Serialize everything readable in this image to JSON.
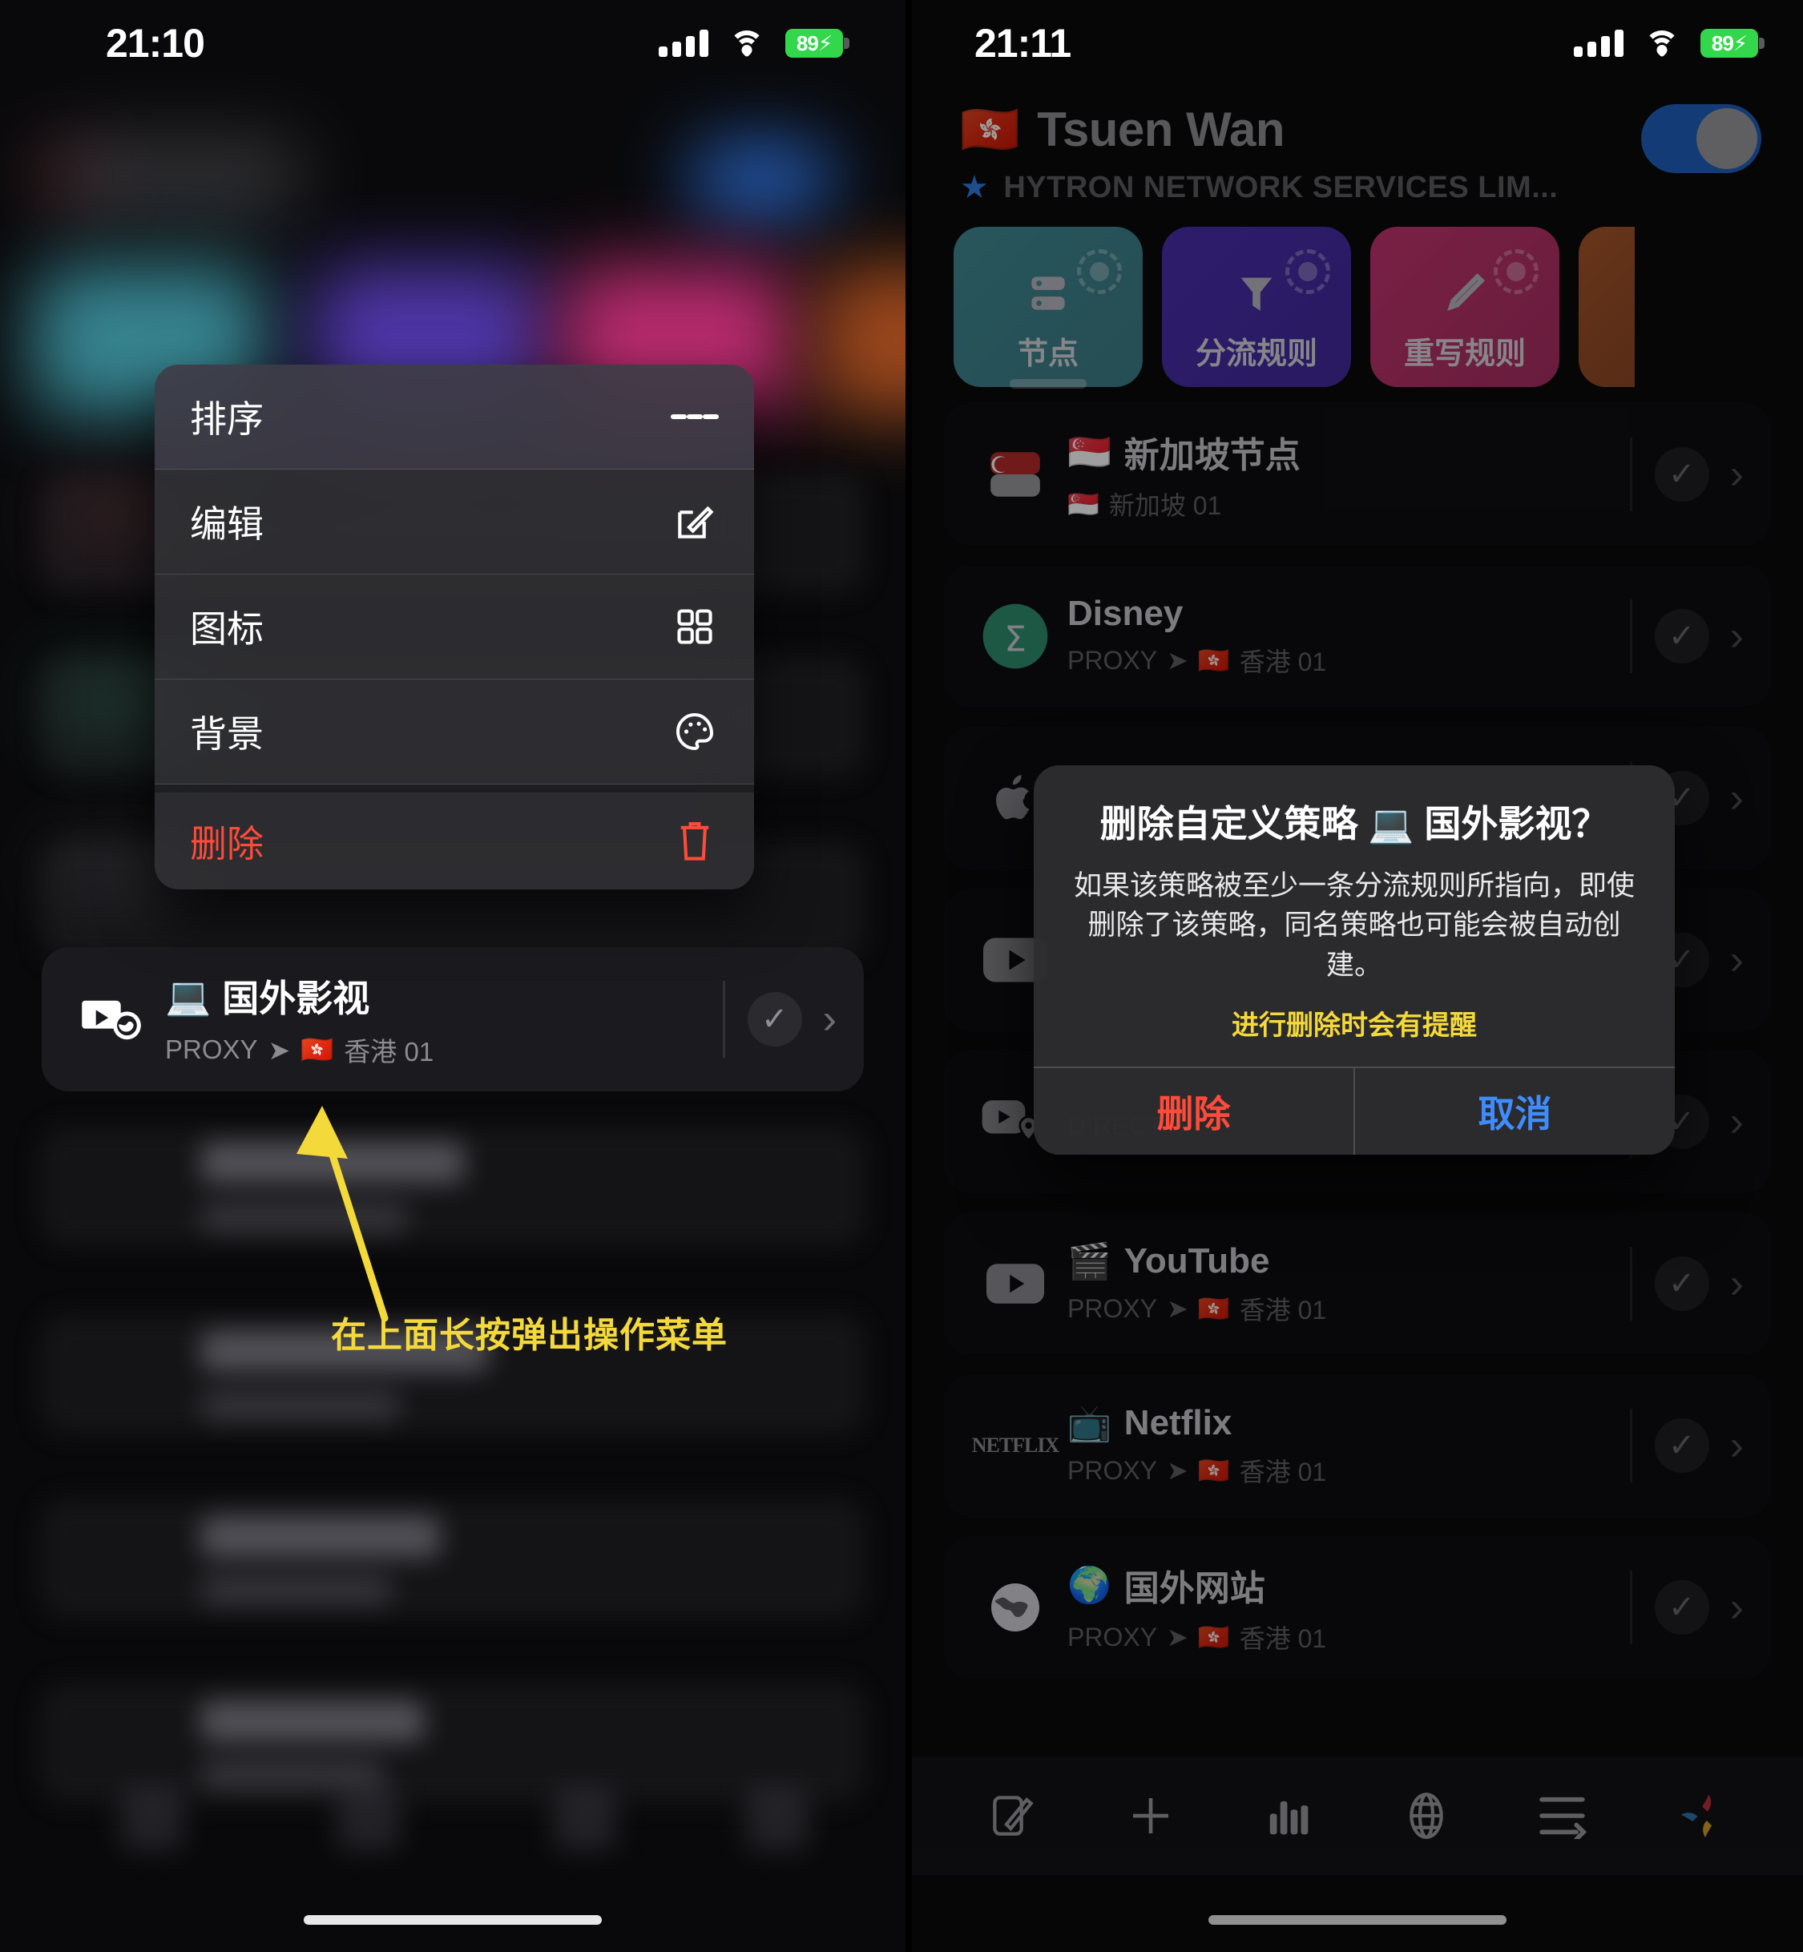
{
  "left": {
    "status": {
      "time": "21:10",
      "battery": "89",
      "battery_charging": true,
      "wifi_icon": "wifi-icon",
      "cellular_icon": "cellular-bars-icon"
    },
    "context_menu": {
      "items": [
        {
          "label": "排序",
          "icon": "hamburger-icon",
          "danger": false
        },
        {
          "label": "编辑",
          "icon": "pencil-square-icon",
          "danger": false
        },
        {
          "label": "图标",
          "icon": "grid-icon",
          "danger": false
        },
        {
          "label": "背景",
          "icon": "palette-icon",
          "danger": false
        },
        {
          "label": "删除",
          "icon": "trash-icon",
          "danger": true
        }
      ]
    },
    "highlighted_card": {
      "emoji": "💻",
      "name": "国外影视",
      "mode": "PROXY",
      "arrow": "➤",
      "flag": "🇭🇰",
      "node": "香港 01",
      "left_icon": "video-globe-icon",
      "check_icon": "check-circle-icon",
      "chevron_icon": "chevron-right-icon"
    },
    "annotation": {
      "text": "在上面长按弹出操作菜单",
      "color": "#f4d93b",
      "arrow_icon": "arrow-up-left-icon"
    }
  },
  "right": {
    "status": {
      "time": "21:11",
      "battery": "89",
      "battery_charging": true,
      "wifi_icon": "wifi-icon",
      "cellular_icon": "cellular-bars-icon"
    },
    "header": {
      "flag": "🇭🇰",
      "title": "Tsuen Wan",
      "star_icon": "star-icon",
      "subtitle": "HYTRON NETWORK SERVICES LIM...",
      "toggle_on": true,
      "toggle_color": "#1f5fbd"
    },
    "tabs": [
      {
        "label": "节点",
        "icon": "server-icon",
        "color": "#3f8b94",
        "active": true
      },
      {
        "label": "分流规则",
        "icon": "funnel-icon",
        "color": "#4a2fae",
        "active": false
      },
      {
        "label": "重写规则",
        "icon": "pencil-icon",
        "color": "#c4356e",
        "active": false
      },
      {
        "label": "",
        "icon": "",
        "color": "#a8562a",
        "active": false
      }
    ],
    "rows": [
      {
        "emoji": "🇸🇬",
        "name": "新加坡节点",
        "mode": "",
        "arrow": "",
        "flag": "🇸🇬",
        "node": "新加坡 01",
        "left_icon": "singapore-flag-icon"
      },
      {
        "emoji": "",
        "name": "Disney",
        "mode": "PROXY",
        "arrow": "➤",
        "flag": "🇭🇰",
        "node": "香港 01",
        "left_icon": "sigma-circle-icon"
      },
      {
        "emoji": "",
        "name": "",
        "mode": "",
        "arrow": "",
        "flag": "",
        "node": "",
        "left_icon": "apple-icon"
      },
      {
        "emoji": "",
        "name": "",
        "mode": "",
        "arrow": "",
        "flag": "",
        "node": "",
        "left_icon": "youtube-icon"
      },
      {
        "emoji": "",
        "name": "",
        "mode": "DIRECT",
        "arrow": "",
        "flag": "",
        "node": "",
        "left_icon": "video-pin-icon"
      },
      {
        "emoji": "🎬",
        "name": "YouTube",
        "mode": "PROXY",
        "arrow": "➤",
        "flag": "🇭🇰",
        "node": "香港 01",
        "left_icon": "youtube-icon"
      },
      {
        "emoji": "📺",
        "name": "Netflix",
        "mode": "PROXY",
        "arrow": "➤",
        "flag": "🇭🇰",
        "node": "香港 01",
        "left_icon": "netflix-icon"
      },
      {
        "emoji": "🌍",
        "name": "国外网站",
        "mode": "PROXY",
        "arrow": "➤",
        "flag": "🇭🇰",
        "node": "香港 01",
        "left_icon": "globe-icon"
      }
    ],
    "alert": {
      "title": "删除自定义策略 💻 国外影视？",
      "message": "如果该策略被至少一条分流规则所指向，即使删除了该策略，同名策略也可能会被自动创建。",
      "note": "进行删除时会有提醒",
      "note_color": "#f4d93b",
      "destructive_label": "删除",
      "destructive_color": "#ff4b3a",
      "cancel_label": "取消",
      "cancel_color": "#3f8cfd"
    },
    "toolbar": [
      {
        "icon": "compose-icon"
      },
      {
        "icon": "plus-icon"
      },
      {
        "icon": "chart-bar-icon"
      },
      {
        "icon": "globe-icon"
      },
      {
        "icon": "list-arrow-icon"
      },
      {
        "icon": "pinwheel-icon"
      }
    ]
  }
}
